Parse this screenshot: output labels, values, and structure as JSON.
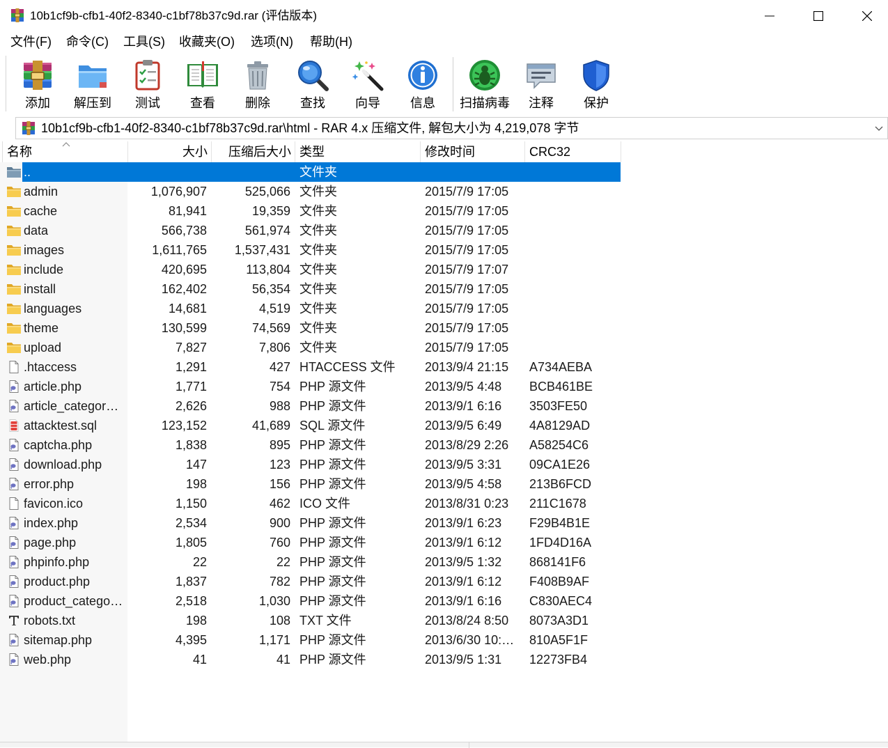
{
  "window": {
    "title": "10b1cf9b-cfb1-40f2-8340-c1bf78b37c9d.rar (评估版本)",
    "app_icon": "winrar-app-icon",
    "controls": {
      "minimize_icon": "minimize-icon",
      "maximize_icon": "maximize-icon",
      "close_icon": "close-icon"
    }
  },
  "menu": [
    "文件(F)",
    "命令(C)",
    "工具(S)",
    "收藏夹(O)",
    "选项(N)",
    "帮助(H)"
  ],
  "toolbar": [
    {
      "label": "添加",
      "icon": "add-archive-icon"
    },
    {
      "label": "解压到",
      "icon": "extract-to-icon"
    },
    {
      "label": "测试",
      "icon": "test-icon"
    },
    {
      "label": "查看",
      "icon": "view-icon"
    },
    {
      "label": "删除",
      "icon": "delete-icon"
    },
    {
      "label": "查找",
      "icon": "find-icon"
    },
    {
      "label": "向导",
      "icon": "wizard-icon"
    },
    {
      "label": "信息",
      "icon": "info-icon"
    },
    {
      "label": "扫描病毒",
      "icon": "virus-scan-icon"
    },
    {
      "label": "注释",
      "icon": "comment-icon"
    },
    {
      "label": "保护",
      "icon": "protect-icon"
    }
  ],
  "path_bar": {
    "icon": "winrar-archive-icon",
    "text": "10b1cf9b-cfb1-40f2-8340-c1bf78b37c9d.rar\\html - RAR 4.x 压缩文件, 解包大小为 4,219,078 字节",
    "dropdown_icon": "chevron-down-icon"
  },
  "columns": {
    "name": "名称",
    "size": "大小",
    "packed": "压缩后大小",
    "type": "类型",
    "modified": "修改时间",
    "crc": "CRC32"
  },
  "sort_icon": "sort-ascending-icon",
  "colors": {
    "selection": "#0078d7",
    "selection_text": "#ffffff"
  },
  "files": [
    {
      "name": "..",
      "size": "",
      "packed": "",
      "type": "文件夹",
      "modified": "",
      "crc": "",
      "icon": "parent-folder-icon",
      "selected": true
    },
    {
      "name": "admin",
      "size": "1,076,907",
      "packed": "525,066",
      "type": "文件夹",
      "modified": "2015/7/9 17:05",
      "crc": "",
      "icon": "folder-icon"
    },
    {
      "name": "cache",
      "size": "81,941",
      "packed": "19,359",
      "type": "文件夹",
      "modified": "2015/7/9 17:05",
      "crc": "",
      "icon": "folder-icon"
    },
    {
      "name": "data",
      "size": "566,738",
      "packed": "561,974",
      "type": "文件夹",
      "modified": "2015/7/9 17:05",
      "crc": "",
      "icon": "folder-icon"
    },
    {
      "name": "images",
      "size": "1,611,765",
      "packed": "1,537,431",
      "type": "文件夹",
      "modified": "2015/7/9 17:05",
      "crc": "",
      "icon": "folder-icon"
    },
    {
      "name": "include",
      "size": "420,695",
      "packed": "113,804",
      "type": "文件夹",
      "modified": "2015/7/9 17:07",
      "crc": "",
      "icon": "folder-icon"
    },
    {
      "name": "install",
      "size": "162,402",
      "packed": "56,354",
      "type": "文件夹",
      "modified": "2015/7/9 17:05",
      "crc": "",
      "icon": "folder-icon"
    },
    {
      "name": "languages",
      "size": "14,681",
      "packed": "4,519",
      "type": "文件夹",
      "modified": "2015/7/9 17:05",
      "crc": "",
      "icon": "folder-icon"
    },
    {
      "name": "theme",
      "size": "130,599",
      "packed": "74,569",
      "type": "文件夹",
      "modified": "2015/7/9 17:05",
      "crc": "",
      "icon": "folder-icon"
    },
    {
      "name": "upload",
      "size": "7,827",
      "packed": "7,806",
      "type": "文件夹",
      "modified": "2015/7/9 17:05",
      "crc": "",
      "icon": "folder-icon"
    },
    {
      "name": ".htaccess",
      "size": "1,291",
      "packed": "427",
      "type": "HTACCESS 文件",
      "modified": "2013/9/4 21:15",
      "crc": "A734AEBA",
      "icon": "file-icon"
    },
    {
      "name": "article.php",
      "size": "1,771",
      "packed": "754",
      "type": "PHP 源文件",
      "modified": "2013/9/5 4:48",
      "crc": "BCB461BE",
      "icon": "php-file-icon"
    },
    {
      "name": "article_categor…",
      "size": "2,626",
      "packed": "988",
      "type": "PHP 源文件",
      "modified": "2013/9/1 6:16",
      "crc": "3503FE50",
      "icon": "php-file-icon"
    },
    {
      "name": "attacktest.sql",
      "size": "123,152",
      "packed": "41,689",
      "type": "SQL 源文件",
      "modified": "2013/9/5 6:49",
      "crc": "4A8129AD",
      "icon": "sql-file-icon"
    },
    {
      "name": "captcha.php",
      "size": "1,838",
      "packed": "895",
      "type": "PHP 源文件",
      "modified": "2013/8/29 2:26",
      "crc": "A58254C6",
      "icon": "php-file-icon"
    },
    {
      "name": "download.php",
      "size": "147",
      "packed": "123",
      "type": "PHP 源文件",
      "modified": "2013/9/5 3:31",
      "crc": "09CA1E26",
      "icon": "php-file-icon"
    },
    {
      "name": "error.php",
      "size": "198",
      "packed": "156",
      "type": "PHP 源文件",
      "modified": "2013/9/5 4:58",
      "crc": "213B6FCD",
      "icon": "php-file-icon"
    },
    {
      "name": "favicon.ico",
      "size": "1,150",
      "packed": "462",
      "type": "ICO 文件",
      "modified": "2013/8/31 0:23",
      "crc": "211C1678",
      "icon": "ico-file-icon"
    },
    {
      "name": "index.php",
      "size": "2,534",
      "packed": "900",
      "type": "PHP 源文件",
      "modified": "2013/9/1 6:23",
      "crc": "F29B4B1E",
      "icon": "php-file-icon"
    },
    {
      "name": "page.php",
      "size": "1,805",
      "packed": "760",
      "type": "PHP 源文件",
      "modified": "2013/9/1 6:12",
      "crc": "1FD4D16A",
      "icon": "php-file-icon"
    },
    {
      "name": "phpinfo.php",
      "size": "22",
      "packed": "22",
      "type": "PHP 源文件",
      "modified": "2013/9/5 1:32",
      "crc": "868141F6",
      "icon": "php-file-icon"
    },
    {
      "name": "product.php",
      "size": "1,837",
      "packed": "782",
      "type": "PHP 源文件",
      "modified": "2013/9/1 6:12",
      "crc": "F408B9AF",
      "icon": "php-file-icon"
    },
    {
      "name": "product_catego…",
      "size": "2,518",
      "packed": "1,030",
      "type": "PHP 源文件",
      "modified": "2013/9/1 6:16",
      "crc": "C830AEC4",
      "icon": "php-file-icon"
    },
    {
      "name": "robots.txt",
      "size": "198",
      "packed": "108",
      "type": "TXT 文件",
      "modified": "2013/8/24 8:50",
      "crc": "8073A3D1",
      "icon": "text-file-icon"
    },
    {
      "name": "sitemap.php",
      "size": "4,395",
      "packed": "1,171",
      "type": "PHP 源文件",
      "modified": "2013/6/30 10:…",
      "crc": "810A5F1F",
      "icon": "php-file-icon"
    },
    {
      "name": "web.php",
      "size": "41",
      "packed": "41",
      "type": "PHP 源文件",
      "modified": "2013/9/5 1:31",
      "crc": "12273FB4",
      "icon": "php-file-icon"
    }
  ]
}
